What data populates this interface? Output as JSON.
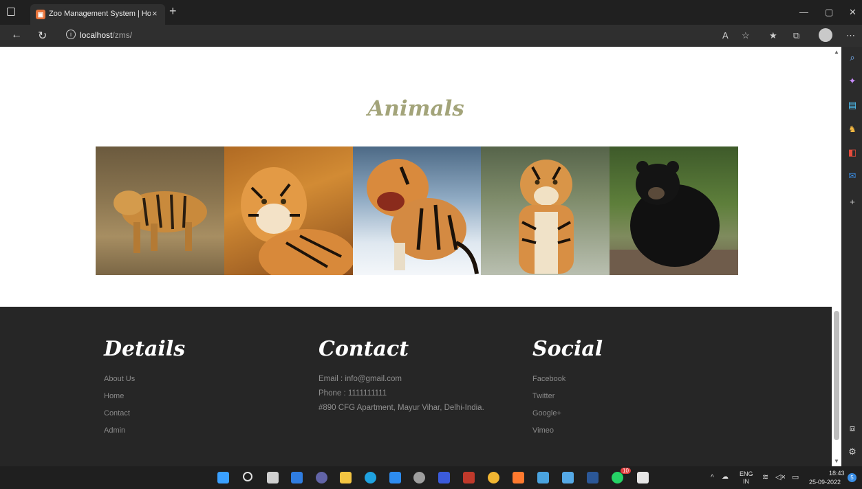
{
  "browser": {
    "tab_title": "Zoo Management System | Home",
    "tab_close": "×",
    "new_tab": "+",
    "url_host": "localhost",
    "url_path": "/zms/"
  },
  "page": {
    "heading": "Animals",
    "gallery": [
      {
        "alt": "Tiger walking in dry grass"
      },
      {
        "alt": "Tiger lying in autumn leaves"
      },
      {
        "alt": "Tiger snarling in snow"
      },
      {
        "alt": "Tiger facing forward"
      },
      {
        "alt": "Black bear sitting on log"
      }
    ]
  },
  "footer": {
    "details": {
      "title": "Details",
      "links": [
        "About Us",
        "Home",
        "Contact",
        "Admin"
      ]
    },
    "contact": {
      "title": "Contact",
      "email": "Email : info@gmail.com",
      "phone": "Phone : 1111111111",
      "address": "#890 CFG Apartment, Mayur Vihar, Delhi-India."
    },
    "social": {
      "title": "Social",
      "links": [
        "Facebook",
        "Twitter",
        "Google+",
        "Vimeo"
      ]
    }
  },
  "system_tray": {
    "lang_top": "ENG",
    "lang_bottom": "IN",
    "time": "18:43",
    "date": "25-09-2022",
    "notification_count": "5",
    "whatsapp_badge": "10"
  }
}
